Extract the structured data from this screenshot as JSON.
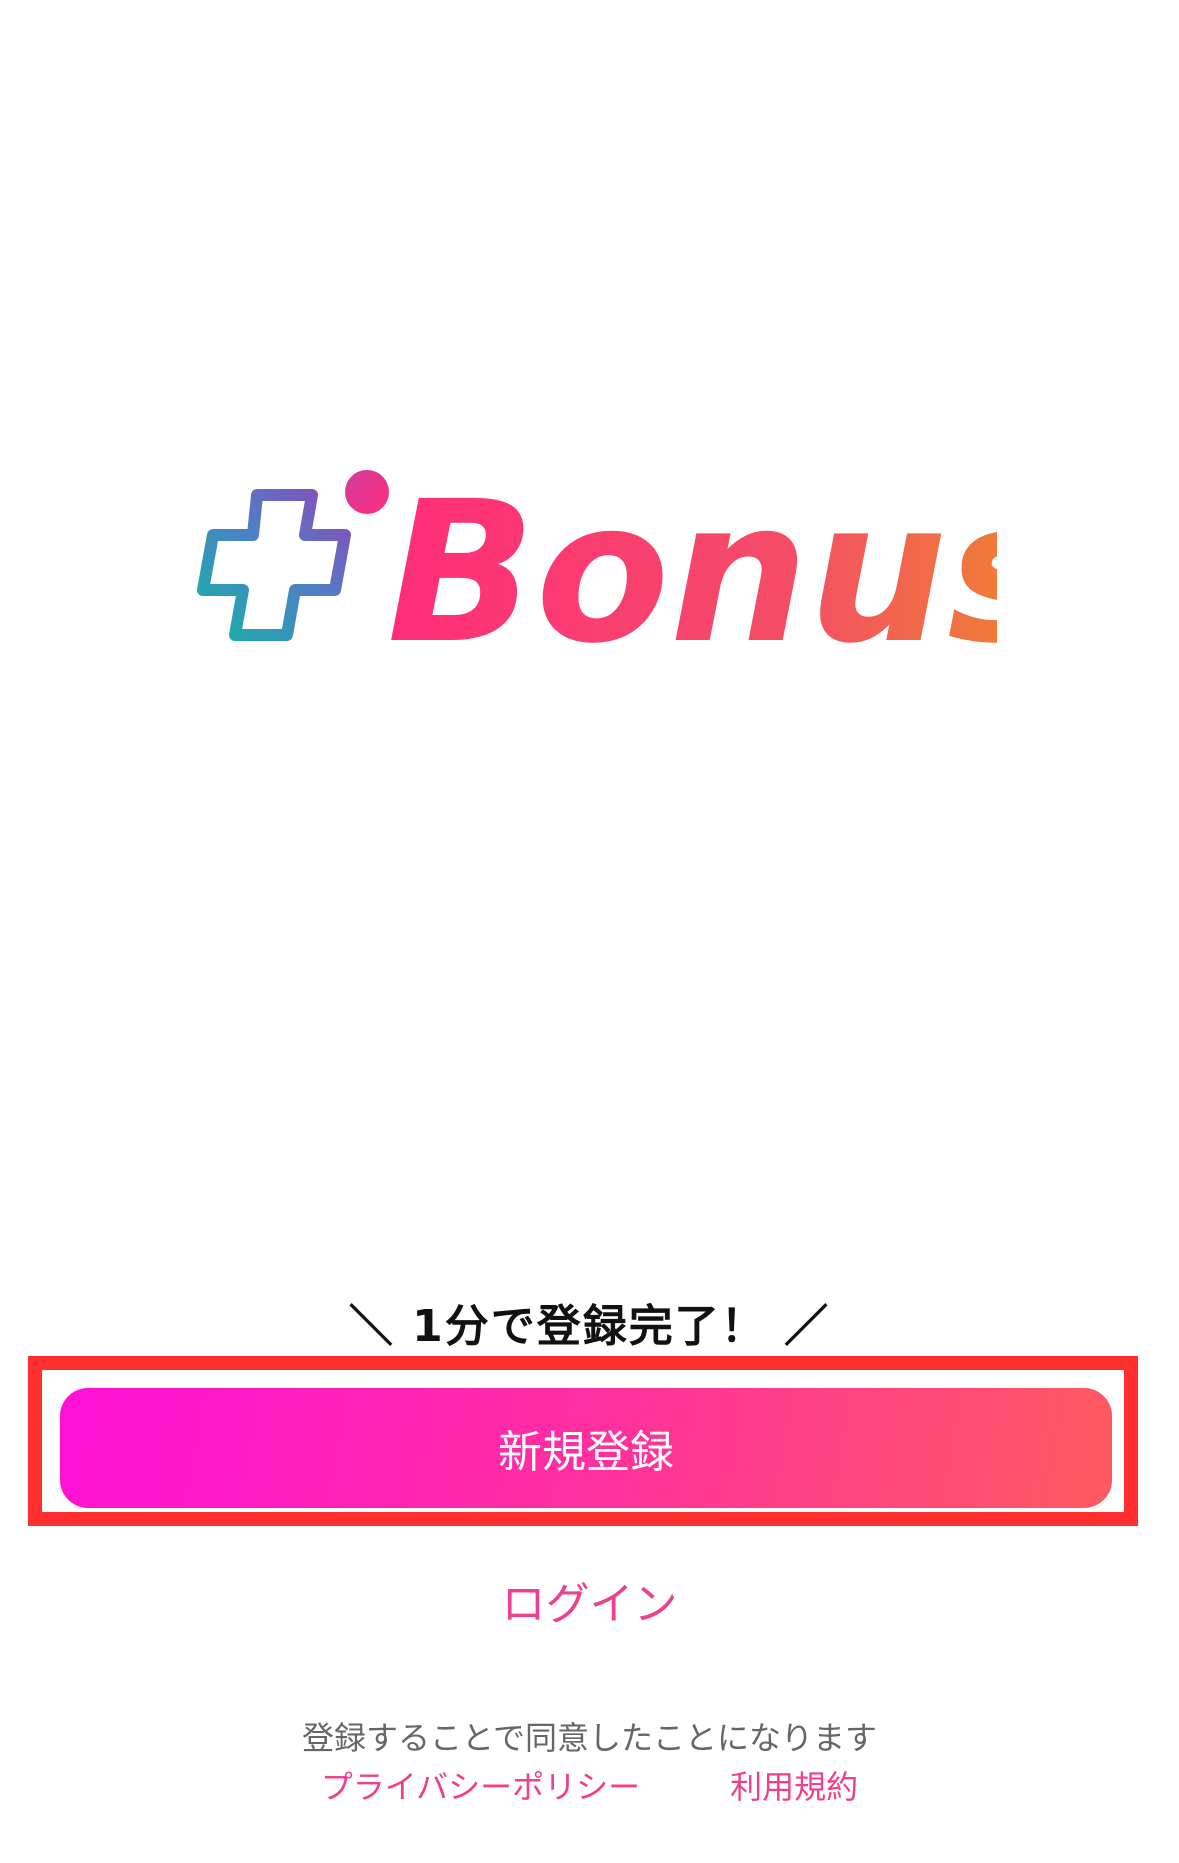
{
  "logo": {
    "text": "Bonus",
    "icon": "plus-i-icon"
  },
  "tagline": "＼ 1分で登録完了！ ／",
  "signup_button": "新規登録",
  "login_link": "ログイン",
  "agreement_text": "登録することで同意したことになります",
  "legal_links": {
    "privacy": "プライバシーポリシー",
    "terms": "利用規約"
  },
  "colors": {
    "accent": "#ef3f8f",
    "highlight_frame": "#ff2e2e",
    "button_gradient_start": "#ff10d8",
    "button_gradient_end": "#ff5a60"
  }
}
